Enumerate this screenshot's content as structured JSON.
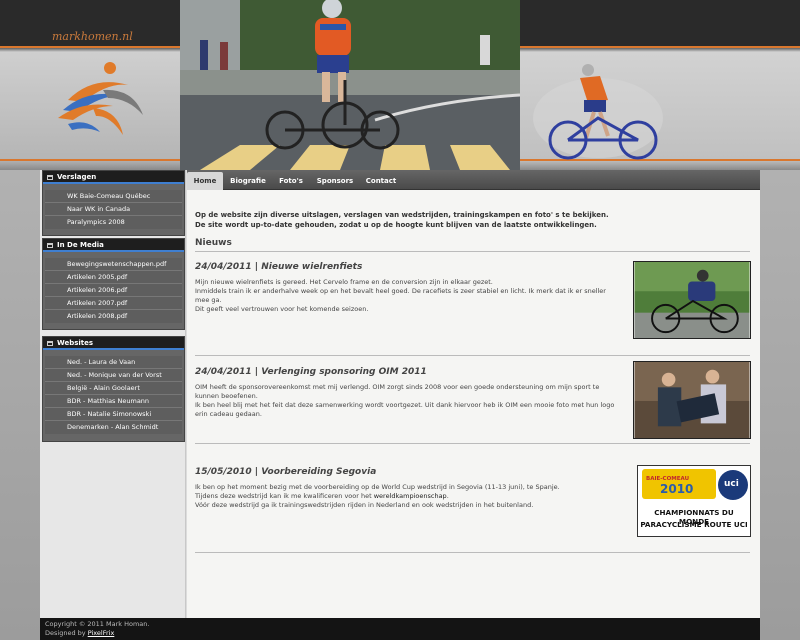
{
  "header": {
    "brand": "markhomen.nl"
  },
  "sidebar": {
    "blocks": [
      {
        "title": "Verslagen",
        "items": [
          "WK Baie-Comeau Québec",
          "Naar WK in Canada",
          "Paralympics 2008"
        ]
      },
      {
        "title": "In De Media",
        "items": [
          "Bewegingswetenschappen.pdf",
          "Artikelen 2005.pdf",
          "Artikelen 2006.pdf",
          "Artikelen 2007.pdf",
          "Artikelen 2008.pdf"
        ]
      },
      {
        "title": "Websites",
        "items": [
          "Ned. - Laura de Vaan",
          "Ned. - Monique van der Vorst",
          "België - Alain Goolaert",
          "BDR - Matthias Neumann",
          "BDR - Natalie Simonowski",
          "Denemarken - Alan Schmidt"
        ]
      }
    ]
  },
  "nav": {
    "tabs": [
      "Home",
      "Biografie",
      "Foto's",
      "Sponsors",
      "Contact"
    ],
    "active": "Home"
  },
  "main": {
    "intro_line1": "Op de website zijn diverse uitslagen, verslagen van wedstrijden, trainingskampen en foto' s te bekijken.",
    "intro_line2": "De site wordt up-to-date gehouden, zodat u op de hoogte kunt blijven van de laatste ontwikkelingen.",
    "section_title": "Nieuws",
    "posts": [
      {
        "date": "24/04/2011",
        "title": "Nieuwe wielrenfiets",
        "lines": [
          "Mijn nieuwe wielrenfiets is gereed. Het Cervelo frame en de conversion zijn in elkaar gezet.",
          "Inmiddels train ik er anderhalve week op en het bevalt heel goed. De racefiets is zeer stabiel en licht. Ik merk dat ik er sneller mee ga.",
          "Dit geeft veel vertrouwen voor het komende seizoen."
        ]
      },
      {
        "date": "24/04/2011",
        "title": "Verlenging sponsoring OIM 2011",
        "lines": [
          "OIM heeft de sponsorovereenkomst met mij verlengd. OIM zorgt sinds 2008 voor een goede ondersteuning om mijn sport te kunnen beoefenen.",
          "Ik ben heel blij met het feit dat deze samenwerking wordt voortgezet. Uit dank hiervoor heb ik OIM een mooie foto met hun logo erin cadeau gedaan."
        ]
      },
      {
        "date": "15/05/2010",
        "title": "Voorbereiding Segovia",
        "line1": "Ik ben op het moment bezig met de voorbereiding op de World Cup wedstrijd in Segovia (11-13 juni), te Spanje.",
        "line2_pre": "Tijdens deze wedstrijd kan ik me kwalificeren voor het ",
        "line2_link": "wereldkampioenschap",
        "line2_post": ".",
        "line3": "Vóór deze wedstrijd ga ik trainingswedstrijden rijden in Nederland en ook wedstrijden in het buitenland."
      }
    ],
    "badge": {
      "top": "BAIE-COMEAU",
      "year": "2010",
      "uci": "uci",
      "line1": "CHAMPIONNATS DU MONDE",
      "line2": "PARACYCLISME ROUTE UCI"
    }
  },
  "footer": {
    "copyright": "Copyright © 2011 Mark Homan.",
    "designed_by": "Designed by ",
    "designer": "PixelFrix"
  }
}
